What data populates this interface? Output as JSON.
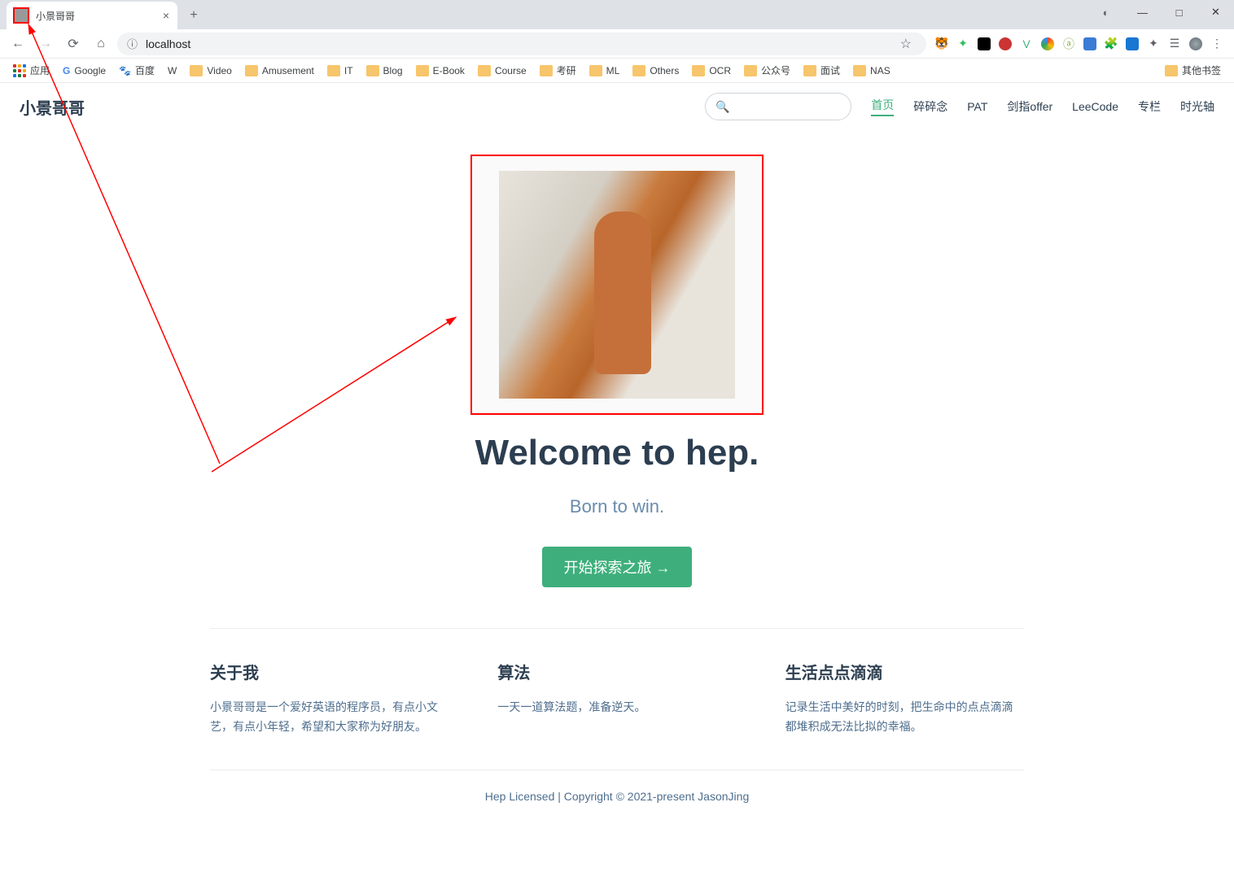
{
  "browser": {
    "tab_title": "小景哥哥",
    "address": "localhost",
    "window": {
      "minimize": "—",
      "maximize": "□",
      "close": "✕"
    }
  },
  "bookmarks": {
    "apps": "应用",
    "items": [
      "Google",
      "百度",
      "W",
      "Video",
      "Amusement",
      "IT",
      "Blog",
      "E-Book",
      "Course",
      "考研",
      "ML",
      "Others",
      "OCR",
      "公众号",
      "面试",
      "NAS"
    ],
    "other": "其他书签"
  },
  "site": {
    "title": "小景哥哥",
    "nav": [
      "首页",
      "碎碎念",
      "PAT",
      "剑指offer",
      "LeeCode",
      "专栏",
      "时光轴"
    ],
    "active_nav_index": 0
  },
  "hero": {
    "heading": "Welcome to hep.",
    "subtitle": "Born to win.",
    "cta": "开始探索之旅 →"
  },
  "features": [
    {
      "title": "关于我",
      "desc": "小景哥哥是一个爱好英语的程序员，有点小文艺，有点小年轻，希望和大家称为好朋友。"
    },
    {
      "title": "算法",
      "desc": "一天一道算法题，准备逆天。"
    },
    {
      "title": "生活点点滴滴",
      "desc": "记录生活中美好的时刻，把生命中的点点滴滴都堆积成无法比拟的幸福。"
    }
  ],
  "footer": "Hep Licensed | Copyright © 2021-present JasonJing"
}
